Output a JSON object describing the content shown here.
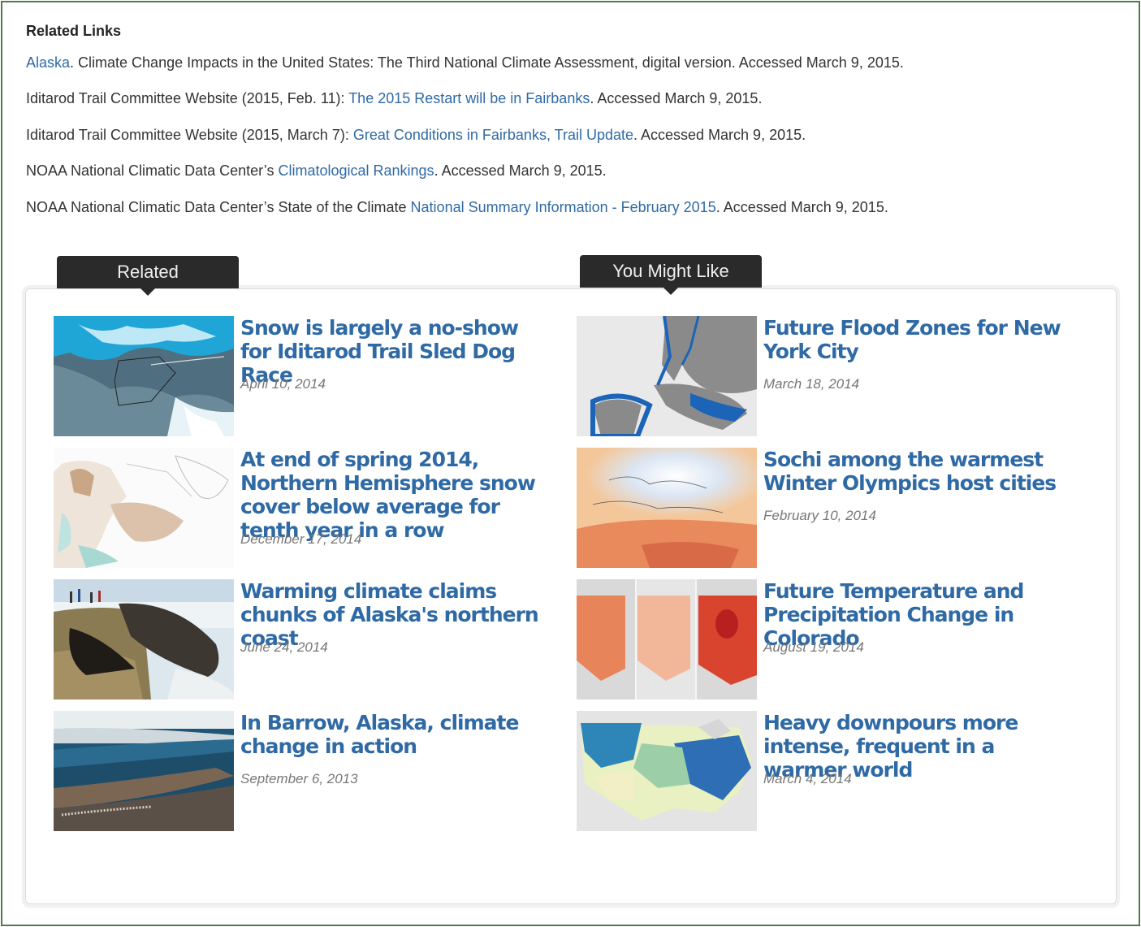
{
  "related_links": {
    "heading": "Related Links",
    "items": [
      {
        "before": "",
        "link": "Alaska",
        "after": ". Climate Change Impacts in the United States: The Third National Climate Assessment, digital version. Accessed March 9, 2015."
      },
      {
        "before": "Iditarod Trail Committee Website (2015, Feb. 11): ",
        "link": "The 2015 Restart will be in Fairbanks",
        "after": ". Accessed March 9, 2015."
      },
      {
        "before": "Iditarod Trail Committee Website (2015, March 7): ",
        "link": "Great Conditions in Fairbanks, Trail Update",
        "after": ". Accessed March 9, 2015."
      },
      {
        "before": "NOAA National Climatic Data Center’s ",
        "link": "Climatological Rankings",
        "after": ". Accessed March 9, 2015."
      },
      {
        "before": "NOAA National Climatic Data Center’s State of the Climate ",
        "link": "National Summary Information - February 2015",
        "after": ". Accessed March 9, 2015."
      }
    ]
  },
  "tabs": {
    "related": "Related",
    "might_like": "You Might Like"
  },
  "related": [
    {
      "title": "Snow is largely a no-show for Iditarod Trail Sled Dog Race",
      "date": "April 10, 2014",
      "thumb": "snow-map-thumbnail"
    },
    {
      "title": "At end of spring 2014, Northern Hemisphere snow cover below average for tenth year in a row",
      "date": "December 17, 2014",
      "thumb": "snow-cover-map-thumbnail"
    },
    {
      "title": "Warming climate claims chunks of Alaska's northern coast",
      "date": "June 24, 2014",
      "thumb": "eroding-coast-photo"
    },
    {
      "title": "In Barrow, Alaska, climate change in action",
      "date": "September 6, 2013",
      "thumb": "barrow-aerial-photo"
    }
  ],
  "might_like": [
    {
      "title": "Future Flood Zones for New York City",
      "date": "March 18, 2014",
      "thumb": "nyc-flood-map-thumbnail"
    },
    {
      "title": "Sochi among the warmest Winter Olympics host cities",
      "date": "February 10, 2014",
      "thumb": "europe-temperature-map-thumbnail"
    },
    {
      "title": "Future Temperature and Precipitation Change in Colorado",
      "date": "August 19, 2014",
      "thumb": "colorado-maps-thumbnail"
    },
    {
      "title": "Heavy downpours more intense, frequent in a warmer world",
      "date": "March 4, 2014",
      "thumb": "us-precipitation-map-thumbnail"
    }
  ],
  "colors": {
    "link": "#2f6aa5",
    "tab_bg": "#2a2a2a",
    "frame_border": "#4f7a4f"
  }
}
